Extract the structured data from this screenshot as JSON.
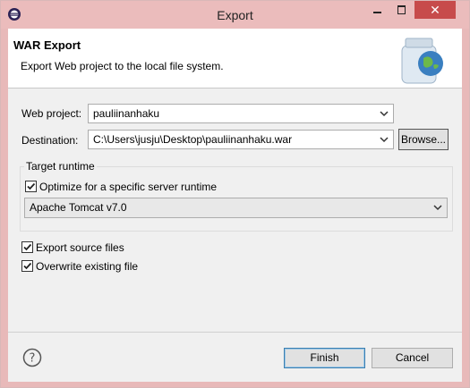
{
  "window": {
    "title": "Export",
    "close_label": "✕"
  },
  "header": {
    "title": "WAR Export",
    "description": "Export Web project to the local file system."
  },
  "form": {
    "web_project_label": "Web project:",
    "web_project_value": "pauliinanhaku",
    "destination_label": "Destination:",
    "destination_value": "C:\\Users\\jusju\\Desktop\\pauliinanhaku.war",
    "browse_label": "Browse..."
  },
  "runtime": {
    "group_title": "Target runtime",
    "optimize_label": "Optimize for a specific server runtime",
    "optimize_checked": true,
    "server_value": "Apache Tomcat v7.0"
  },
  "options": {
    "export_source_label": "Export source files",
    "export_source_checked": true,
    "overwrite_label": "Overwrite existing file",
    "overwrite_checked": true
  },
  "footer": {
    "finish_label": "Finish",
    "cancel_label": "Cancel"
  },
  "icons": {
    "app": "eclipse-icon",
    "help": "help-icon",
    "header": "war-jar-globe-icon",
    "dropdown": "chevron-down-icon",
    "check": "checkmark-icon"
  },
  "colors": {
    "titlebar": "#ebbcbc",
    "close_button": "#c74b4b",
    "header_bg": "#ffffff",
    "body_bg": "#f0f0f0",
    "focus_border": "#3c7fb1"
  }
}
